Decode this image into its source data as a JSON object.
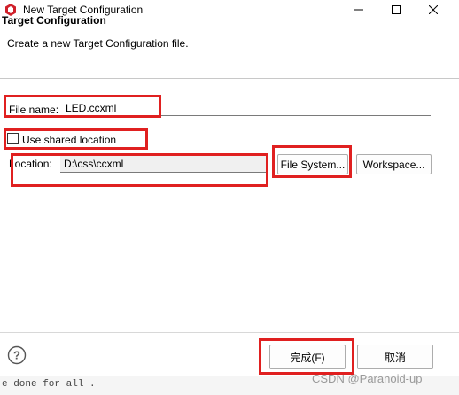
{
  "window": {
    "title": "New Target Configuration",
    "icon": "target-config-icon",
    "controls": [
      "minimize-icon",
      "maximize-icon",
      "close-icon"
    ]
  },
  "header": {
    "title": "Target Configuration",
    "description": "Create a new Target Configuration file."
  },
  "form": {
    "file_name_label": "File name:",
    "file_name_value": "LED.ccxml",
    "shared_location_label": "Use shared location",
    "shared_location_checked": false,
    "location_label": "Location:",
    "location_value": "D:\\css\\ccxml",
    "file_system_label": "File System...",
    "workspace_label": "Workspace..."
  },
  "footer": {
    "help_icon": "help-icon",
    "finish_label": "完成(F)",
    "cancel_label": "取消"
  },
  "background": {
    "console_text": "e done for  all ."
  },
  "watermark": "CSDN @Paranoid-up",
  "colors": {
    "highlight": "#e02020",
    "dialog_bg": "#ffffff",
    "button_border": "#adadad"
  }
}
